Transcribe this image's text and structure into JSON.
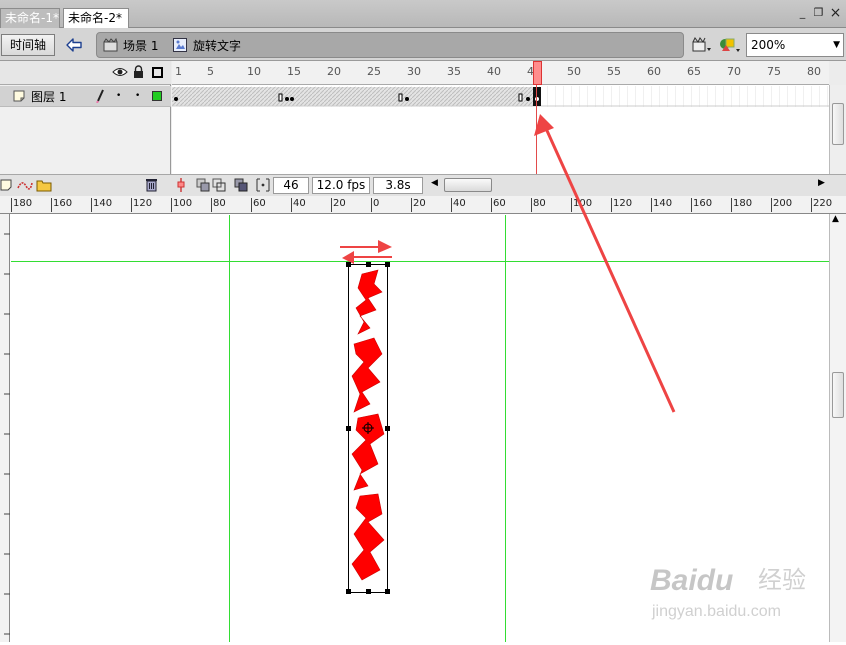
{
  "tabs": [
    {
      "label": "未命名-1*"
    },
    {
      "label": "未命名-2*"
    }
  ],
  "window_controls": {
    "minimize": "_",
    "restore": "❐",
    "close": "×"
  },
  "toolbar": {
    "timeline_button": "时间轴",
    "scene_label": "场景 1",
    "symbol_label": "旋转文字",
    "zoom": "200%"
  },
  "timeline": {
    "layer_name": "图层 1",
    "frame_ticks": [
      "1",
      "5",
      "10",
      "15",
      "20",
      "25",
      "30",
      "35",
      "40",
      "45",
      "50",
      "55",
      "60",
      "65",
      "70",
      "75",
      "80"
    ],
    "current_frame": "46",
    "frame_rate": "12.0 fps",
    "elapsed_time": "3.8s"
  },
  "ruler": {
    "h_ticks": [
      "180",
      "160",
      "140",
      "120",
      "100",
      "80",
      "60",
      "40",
      "20",
      "0",
      "20",
      "40",
      "60",
      "80",
      "100",
      "120",
      "140",
      "160",
      "180",
      "200",
      "220"
    ]
  },
  "colors": {
    "tab_bar": "#c4c4c4",
    "breadcrumb_bar": "#a8a8a8",
    "playhead": "#ff6b6b",
    "guide_line": "#33dd33",
    "glyph": "#ff0000",
    "arrow": "#ee4444",
    "layer_color": "#22cc22"
  },
  "watermark": {
    "brand": "Baidu",
    "brand_cn": "经验",
    "url": "jingyan.baidu.com"
  }
}
